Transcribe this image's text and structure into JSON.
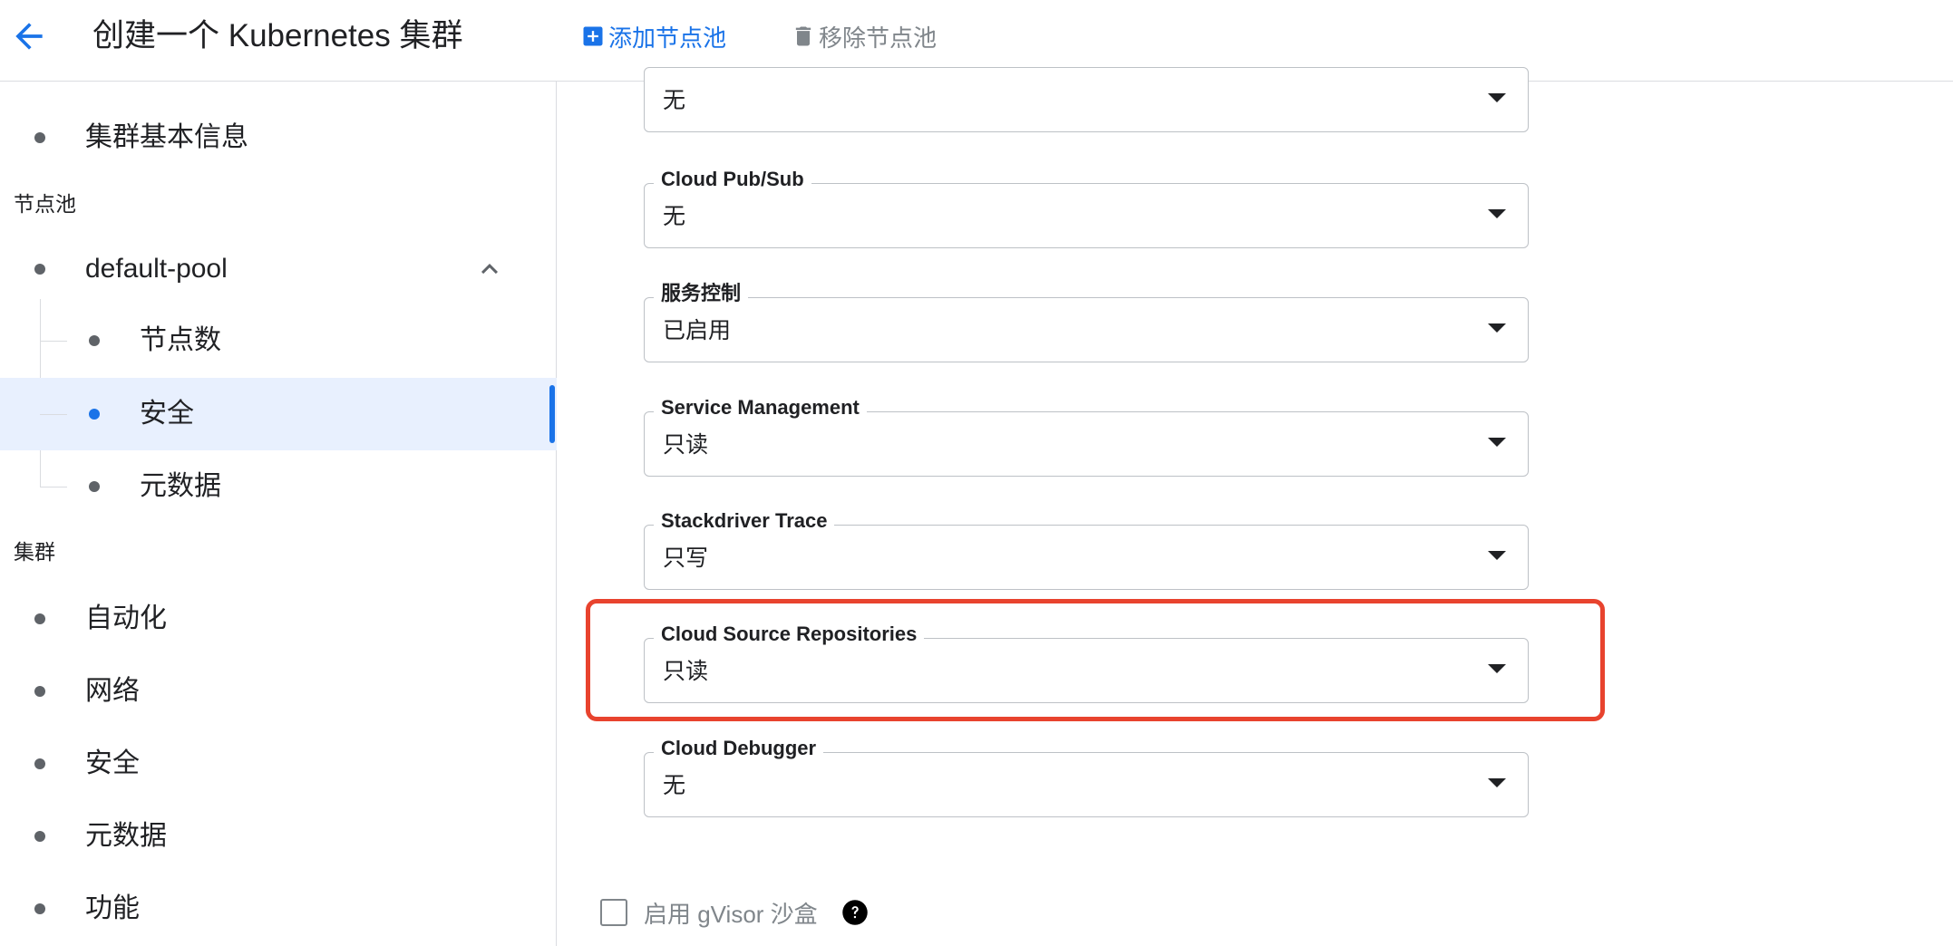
{
  "header": {
    "title": "创建一个 Kubernetes 集群",
    "add_pool_label": "添加节点池",
    "remove_pool_label": "移除节点池"
  },
  "sidebar": {
    "cluster_basics": "集群基本信息",
    "node_pools_heading": "节点池",
    "pool_name": "default-pool",
    "pool_items": [
      "节点数",
      "安全",
      "元数据"
    ],
    "cluster_heading": "集群",
    "cluster_items": [
      "自动化",
      "网络",
      "安全",
      "元数据",
      "功能"
    ]
  },
  "fields": [
    {
      "label": "",
      "value": "无"
    },
    {
      "label": "Cloud Pub/Sub",
      "value": "无"
    },
    {
      "label": "服务控制",
      "value": "已启用"
    },
    {
      "label": "Service Management",
      "value": "只读"
    },
    {
      "label": "Stackdriver Trace",
      "value": "只写"
    },
    {
      "label": "Cloud Source Repositories",
      "value": "只读"
    },
    {
      "label": "Cloud Debugger",
      "value": "无"
    }
  ],
  "gvisor": {
    "label": "启用 gVisor 沙盒",
    "checked": false
  },
  "colors": {
    "accent": "#1a73e8",
    "highlight": "#e8432e",
    "active_bg": "#e8f0fe"
  }
}
